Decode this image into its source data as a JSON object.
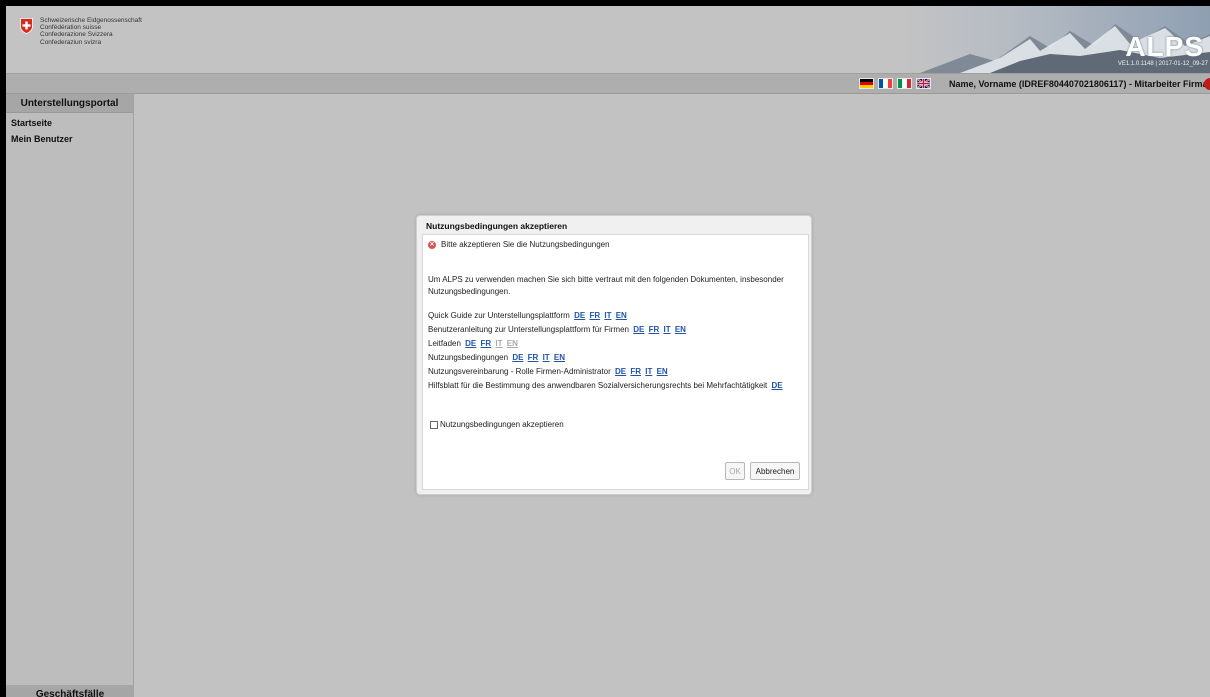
{
  "header": {
    "confederation_lines": [
      "Schweizerische Eidgenossenschaft",
      "Confédération suisse",
      "Confederazione Svizzera",
      "Confederaziun svizra"
    ],
    "app_logo": "ALPS",
    "version": "VE1.1.0.1148 | 2017-01-12_09-27"
  },
  "topbar": {
    "flags": [
      "flag-de-icon",
      "flag-fr-icon",
      "flag-it-icon",
      "flag-en-icon"
    ],
    "user": "Name, Vorname (IDREF804407021806117) - Mitarbeiter Firma"
  },
  "sidebar": {
    "title": "Unterstellungsportal",
    "items": [
      {
        "label": "Startseite"
      },
      {
        "label": "Mein Benutzer"
      }
    ],
    "footer": "Geschäftsfälle"
  },
  "dialog": {
    "title": "Nutzungsbedingungen akzeptieren",
    "error": "Bitte akzeptieren Sie die Nutzungsbedingungen",
    "intro_line1": "Um ALPS zu verwenden machen Sie sich bitte vertraut mit den folgenden Dokumenten, insbesonder",
    "intro_line2": "Nutzungsbedingungen.",
    "documents": [
      {
        "label": "Quick Guide zur Unterstellungsplattform",
        "langs": [
          "DE",
          "FR",
          "IT",
          "EN"
        ]
      },
      {
        "label": "Benutzeranleitung zur Unterstellungsplattform für Firmen",
        "langs": [
          "DE",
          "FR",
          "IT",
          "EN"
        ]
      },
      {
        "label": "Leitfaden",
        "langs": [
          "DE",
          "FR",
          "IT",
          "EN"
        ],
        "disabled": [
          "IT",
          "EN"
        ]
      },
      {
        "label": "Nutzungsbedingungen",
        "langs": [
          "DE",
          "FR",
          "IT",
          "EN"
        ]
      },
      {
        "label": "Nutzungsvereinbarung - Rolle Firmen-Administrator",
        "langs": [
          "DE",
          "FR",
          "IT",
          "EN"
        ]
      },
      {
        "label": "Hilfsblatt für die Bestimmung des anwendbaren Sozialversicherungsrechts bei Mehrfachtätigkeit",
        "langs": [
          "DE"
        ]
      }
    ],
    "checkbox_label": "Nutzungsbedingungen akzeptieren",
    "checkbox_checked": false,
    "ok_label": "OK",
    "cancel_label": "Abbrechen"
  },
  "colors": {
    "background": "#c2c2c2",
    "link": "#1f55a8",
    "error": "#d9534f",
    "swiss_red": "#d52b1e"
  }
}
